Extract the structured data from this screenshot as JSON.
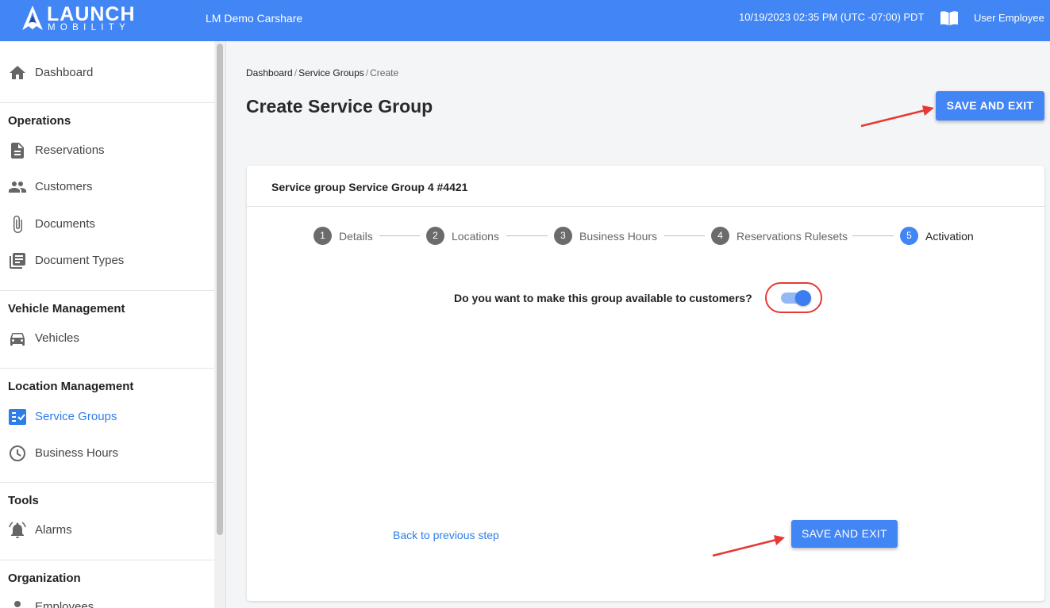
{
  "header": {
    "logo_word": "LAUNCH",
    "logo_sub": "MOBILITY",
    "org_name": "LM Demo Carshare",
    "datetime": "10/19/2023 02:35 PM (UTC -07:00) PDT",
    "user_name": "User Employee",
    "brand_color": "#4285f4"
  },
  "sidebar": {
    "dashboard": "Dashboard",
    "sections": {
      "operations": "Operations",
      "vehicle_management": "Vehicle Management",
      "location_management": "Location Management",
      "tools": "Tools",
      "organization": "Organization"
    },
    "items": {
      "reservations": "Reservations",
      "customers": "Customers",
      "documents": "Documents",
      "document_types": "Document Types",
      "vehicles": "Vehicles",
      "service_groups": "Service Groups",
      "business_hours": "Business Hours",
      "alarms": "Alarms",
      "employees": "Employees"
    },
    "active_item": "Service Groups",
    "active_color": "#2f7ee8"
  },
  "breadcrumb": {
    "items": [
      "Dashboard",
      "Service Groups",
      "Create"
    ],
    "separator": "/"
  },
  "page": {
    "title": "Create Service Group",
    "save_exit_label": "SAVE AND EXIT"
  },
  "card": {
    "title": "Service group Service Group 4 #4421",
    "steps": [
      {
        "num": "1",
        "label": "Details"
      },
      {
        "num": "2",
        "label": "Locations"
      },
      {
        "num": "3",
        "label": "Business Hours"
      },
      {
        "num": "4",
        "label": "Reservations Rulesets"
      },
      {
        "num": "5",
        "label": "Activation"
      }
    ],
    "active_step": 5,
    "question": "Do you want to make this group available to customers?",
    "toggle_on": true,
    "back_label": "Back to previous step",
    "save_exit_label": "SAVE AND EXIT"
  },
  "annotation_color": "#e53935"
}
